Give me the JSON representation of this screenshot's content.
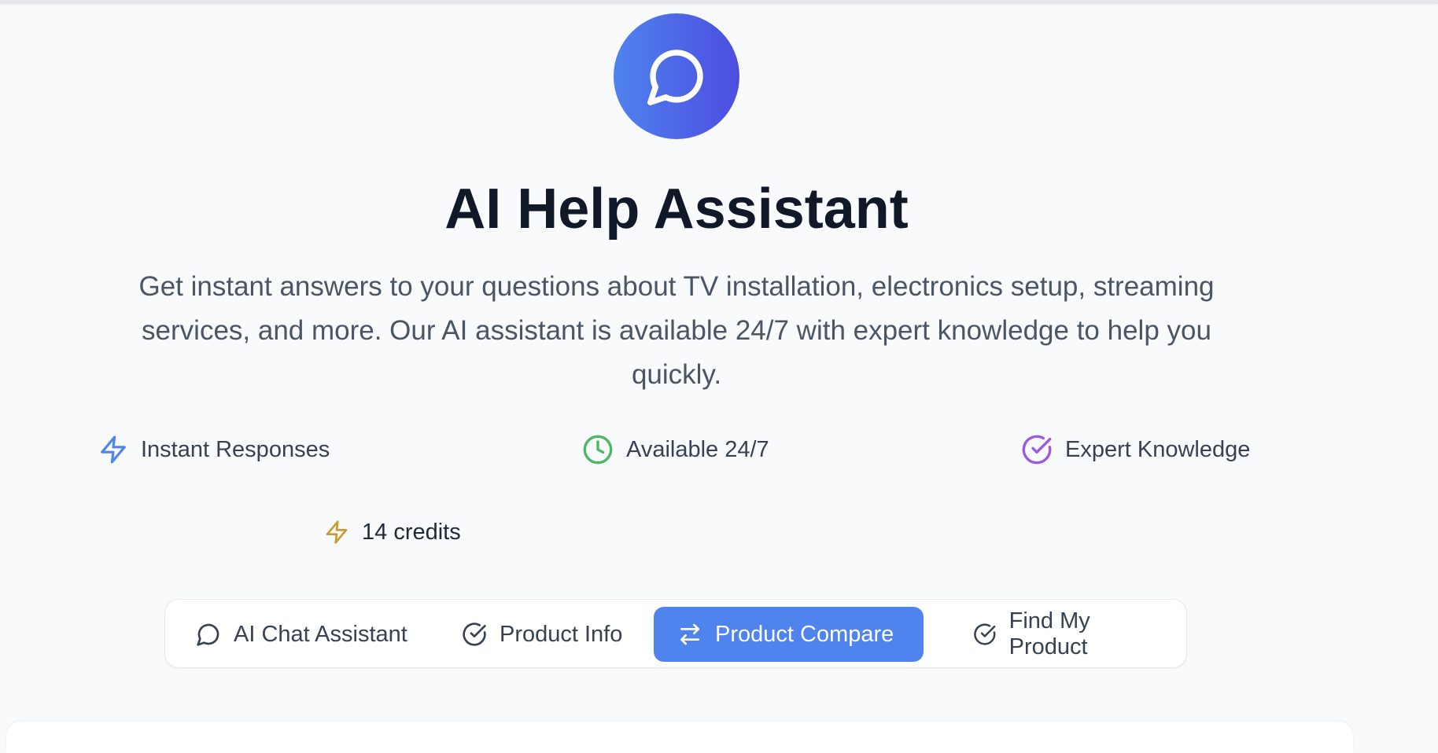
{
  "hero": {
    "icon": "chat-bubble-icon",
    "gradient": [
      "#4f83ee",
      "#4d4de0"
    ]
  },
  "title": "AI Help Assistant",
  "description": "Get instant answers to your questions about TV installation, electronics setup, streaming services, and more. Our AI assistant is available 24/7 with expert knowledge to help you quickly.",
  "features": [
    {
      "label": "Instant Responses",
      "icon": "lightning-icon",
      "color": "#4f83ee"
    },
    {
      "label": "Available 24/7",
      "icon": "clock-icon",
      "color": "#4cb764"
    },
    {
      "label": "Expert Knowledge",
      "icon": "check-circle-icon",
      "color": "#9b59e6"
    }
  ],
  "credits": {
    "label": "14 credits",
    "icon": "lightning-icon",
    "color": "#c89b2c"
  },
  "tabs": [
    {
      "label": "AI Chat Assistant",
      "icon": "chat-bubble-icon",
      "active": false
    },
    {
      "label": "Product Info",
      "icon": "check-circle-icon",
      "active": false
    },
    {
      "label": "Product Compare",
      "icon": "arrows-swap-icon",
      "active": true
    },
    {
      "label": "Find My Product",
      "icon": "check-circle-icon",
      "active": false
    }
  ],
  "colors": {
    "accent": "#4f83ee",
    "background": "#f8fafc",
    "title": "#111827",
    "text": "#4b5563"
  }
}
